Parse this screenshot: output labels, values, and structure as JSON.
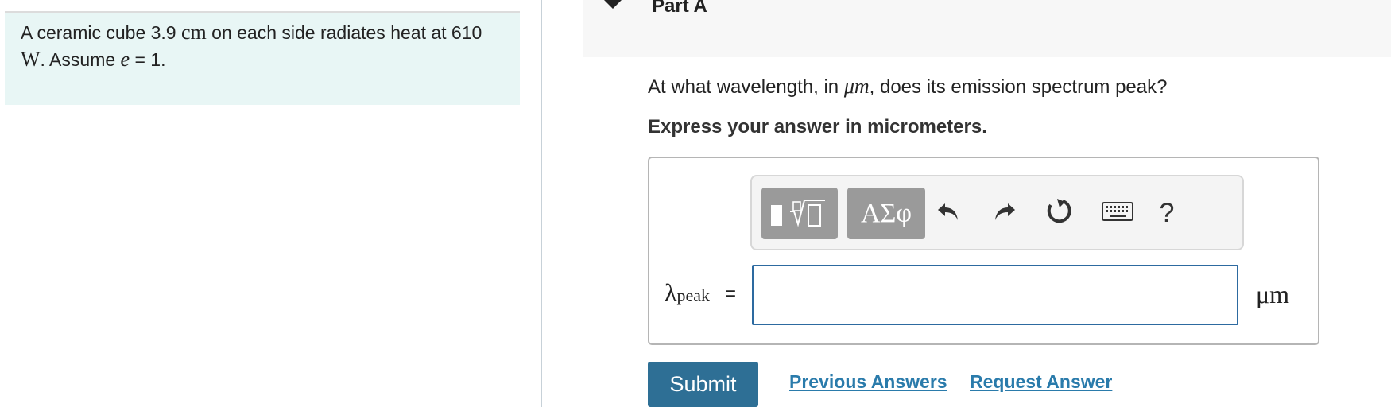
{
  "problem": {
    "text_1": "A ceramic cube 3.9 ",
    "unit_cm": "cm",
    "text_2": " on each side radiates heat at 610 ",
    "unit_w": "W",
    "text_3": ". Assume ",
    "var_e": "e",
    "text_4": " = 1."
  },
  "part": {
    "title": "Part A",
    "question_1": "At what wavelength, in ",
    "question_unit": "μm",
    "question_2": ", does its emission spectrum peak?",
    "instruction": "Express your answer in micrometers."
  },
  "toolbar": {
    "templates_icon": "templates-icon",
    "symbols_label": "ΑΣφ",
    "undo_icon": "undo-icon",
    "redo_icon": "redo-icon",
    "reset_icon": "reset-icon",
    "keyboard_icon": "keyboard-icon",
    "help_label": "?"
  },
  "answer": {
    "variable": "λ",
    "subscript": "peak",
    "equals": "=",
    "value": "",
    "unit": "μm"
  },
  "actions": {
    "submit_label": "Submit",
    "previous_answers_label": "Previous Answers",
    "request_answer_label": "Request Answer"
  },
  "colors": {
    "problem_bg": "#e8f6f5",
    "submit_bg": "#2e6f95",
    "link": "#2a7bab",
    "input_border": "#2d6aa0",
    "toolbar_button": "#9a9a9a"
  }
}
